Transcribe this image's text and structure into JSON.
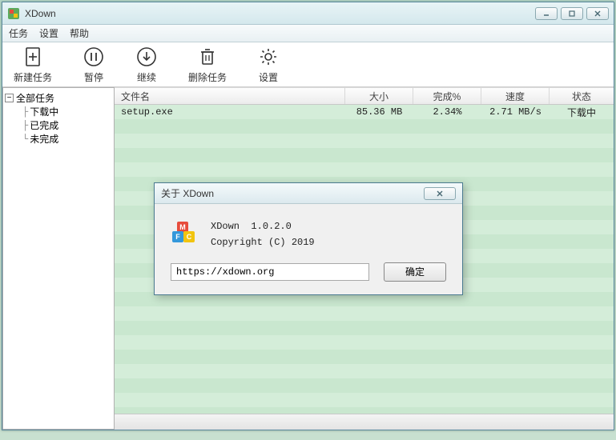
{
  "window": {
    "title": "XDown"
  },
  "menubar": {
    "task": "任务",
    "settings": "设置",
    "help": "帮助"
  },
  "toolbar": {
    "new_task": "新建任务",
    "pause": "暂停",
    "resume": "继续",
    "delete": "删除任务",
    "settings": "设置"
  },
  "sidebar": {
    "root": "全部任务",
    "children": [
      "下载中",
      "已完成",
      "未完成"
    ]
  },
  "table": {
    "headers": {
      "name": "文件名",
      "size": "大小",
      "percent": "完成%",
      "speed": "速度",
      "status": "状态"
    },
    "rows": [
      {
        "name": "setup.exe",
        "size": "85.36 MB",
        "percent": "2.34%",
        "speed": "2.71 MB/s",
        "status": "下载中"
      }
    ]
  },
  "dialog": {
    "title": "关于 XDown",
    "product": "XDown",
    "version": "1.0.2.0",
    "copyright": "Copyright (C) 2019",
    "url": "https://xdown.org",
    "ok": "确定"
  }
}
